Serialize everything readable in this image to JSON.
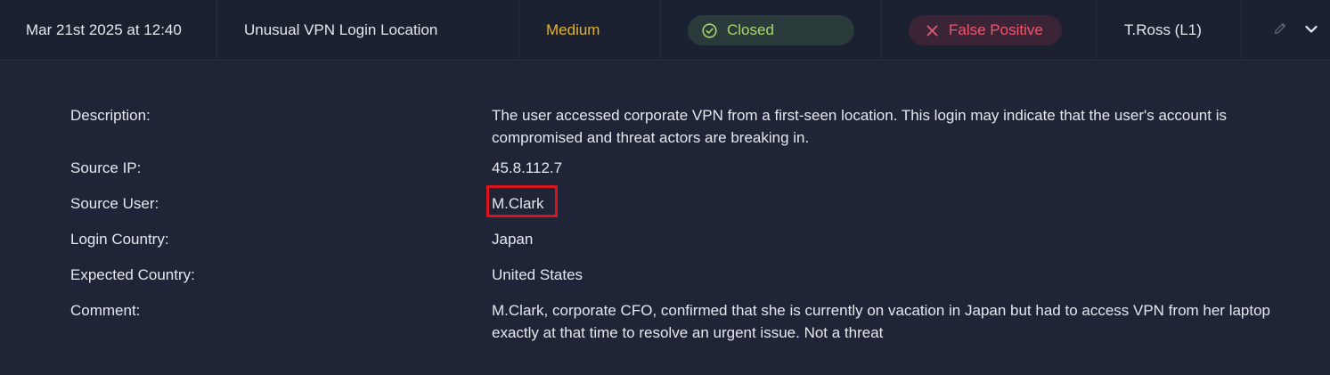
{
  "alert": {
    "date": "Mar 21st 2025 at 12:40",
    "title": "Unusual VPN Login Location",
    "severity": "Medium",
    "status": "Closed",
    "verdict": "False Positive",
    "assignee": "T.Ross (L1)"
  },
  "icons": {
    "status": "check-circle-icon",
    "verdict": "x-icon",
    "edit": "pencil-icon",
    "expand": "chevron-down-icon"
  },
  "colors": {
    "severity_medium": "#e6b422",
    "status_closed": "#a6d86a",
    "verdict_false_positive": "#f0566e",
    "highlight": "#d9141c"
  },
  "details": {
    "description_label": "Description:",
    "description_line1": "The user accessed corporate VPN from a first-seen location. This login may indicate that the user's account is",
    "description_line2": "compromised and threat actors are breaking in.",
    "source_ip_label": "Source IP:",
    "source_ip": "45.8.112.7",
    "source_user_label": "Source User:",
    "source_user": "M.Clark",
    "login_country_label": "Login Country:",
    "login_country": "Japan",
    "expected_country_label": "Expected Country:",
    "expected_country": "United States",
    "comment_label": "Comment:",
    "comment_line1": "M.Clark, corporate CFO, confirmed that she is currently on vacation in Japan but had to access VPN from her laptop",
    "comment_line2": "exactly at that time to resolve an urgent issue. Not a threat"
  }
}
